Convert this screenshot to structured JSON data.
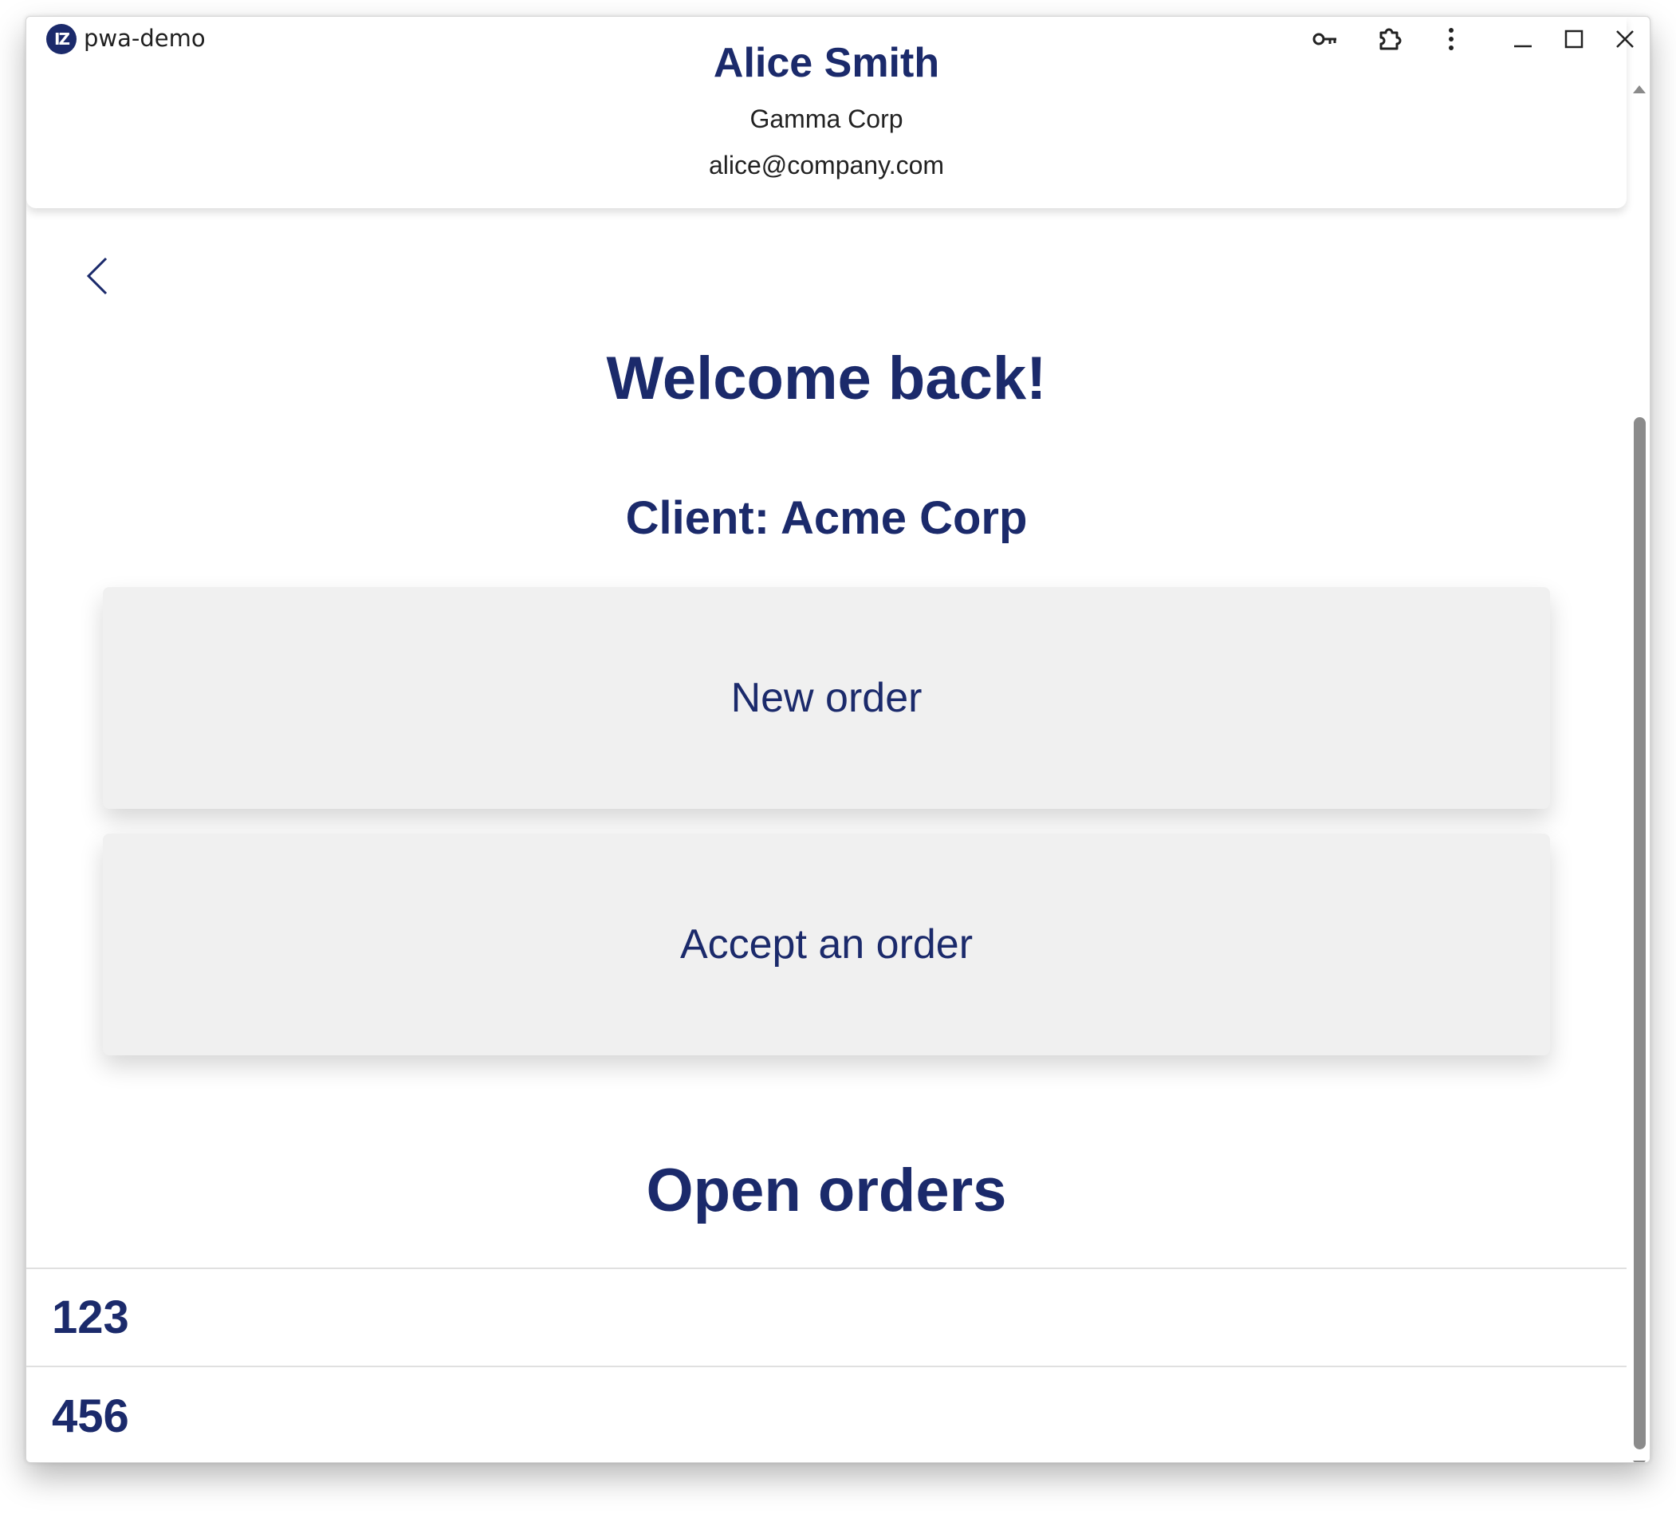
{
  "window": {
    "title": "pwa-demo",
    "logo_text": "IZ"
  },
  "toolbar": {
    "icons": [
      "key-icon",
      "extension-icon",
      "more-vertical-icon",
      "minimize-icon",
      "maximize-icon",
      "close-icon"
    ]
  },
  "profile": {
    "name": "Alice Smith",
    "company": "Gamma Corp",
    "email": "alice@company.com"
  },
  "main": {
    "welcome": "Welcome back!",
    "client": "Client: Acme Corp",
    "actions": [
      {
        "label": "New order"
      },
      {
        "label": "Accept an order"
      }
    ],
    "open_orders_title": "Open orders",
    "orders": [
      "123",
      "456"
    ]
  },
  "colors": {
    "accent": "#1b2a6b",
    "card_bg": "#f0f0f0"
  }
}
